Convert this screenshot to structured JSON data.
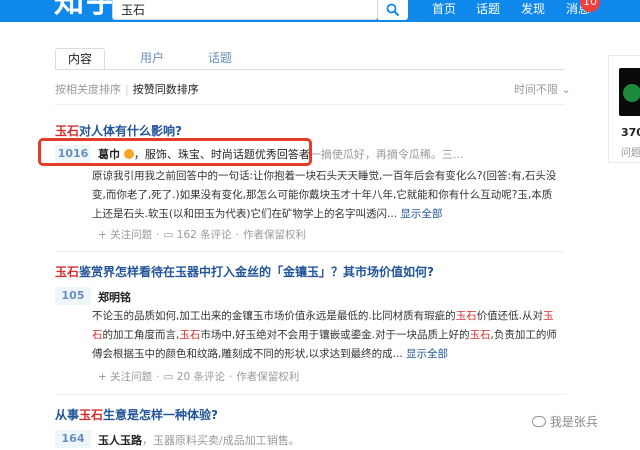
{
  "header": {
    "logo": "知乎",
    "search_value": "玉石",
    "nav": [
      "首页",
      "话题",
      "发现",
      "消息"
    ],
    "badge": "10"
  },
  "tabs": [
    "内容",
    "用户",
    "话题"
  ],
  "sort": {
    "relevance": "按相关度排序",
    "votes": "按赞同数排序",
    "time": "时间不限"
  },
  "results": [
    {
      "q_hl": "玉石",
      "q_rest": "对人体有什么影响?",
      "votes": "1016",
      "author": "葛巾",
      "bio": "，服饰、珠宝、时尚话题优秀回答者",
      "more": "一摘使瓜好，再摘令瓜稀。三...",
      "excerpt": "原谅我引用我之前回答中的一句话:让你抱着一块石头天天睡觉,一百年后会有变化么?(回答:有,石头没变,而你老了,死了.)如果没有变化,那怎么可能你戴块玉才十年八年,它就能和你有什么互动呢?玉,本质上还是石头.软玉(以和田玉为代表)它们在矿物学上的名字叫透闪...",
      "show_all": "显示全部",
      "follow": "关注问题",
      "comments": "162 条评论",
      "rights": "作者保留权利"
    },
    {
      "q_hl": "玉石",
      "q_mid": "鉴赏界怎样看待在玉器中打入金丝的「金镶玉」？其市场价值如何?",
      "votes": "105",
      "author": "郑明铭",
      "excerpt_parts": [
        "不论玉的品质如何,加工出来的金镶玉市场价值永远是最低的.比同材质有瑕疵的",
        "玉石",
        "价值还低.从对",
        "玉石",
        "的加工角度而言,",
        "玉石",
        "市场中,好玉绝对不会用于镶嵌或鎏金.对于一块品质上好的",
        "玉石",
        ",负责加工的师傅会根据玉中的颜色和纹路,雕刻成不同的形状,以求达到最终的成..."
      ],
      "show_all": "显示全部",
      "follow": "关注问题",
      "comments": "20 条评论",
      "rights": "作者保留权利"
    },
    {
      "q_pre": "从事",
      "q_hl": "玉石",
      "q_rest": "生意是怎样一种体验?",
      "votes": "164",
      "author": "玉人玉路",
      "bio": "，玉器原料买卖/成品加工销售。"
    }
  ],
  "sidebar": {
    "count": "370",
    "label": "问题"
  },
  "watermark": "我是张兵"
}
